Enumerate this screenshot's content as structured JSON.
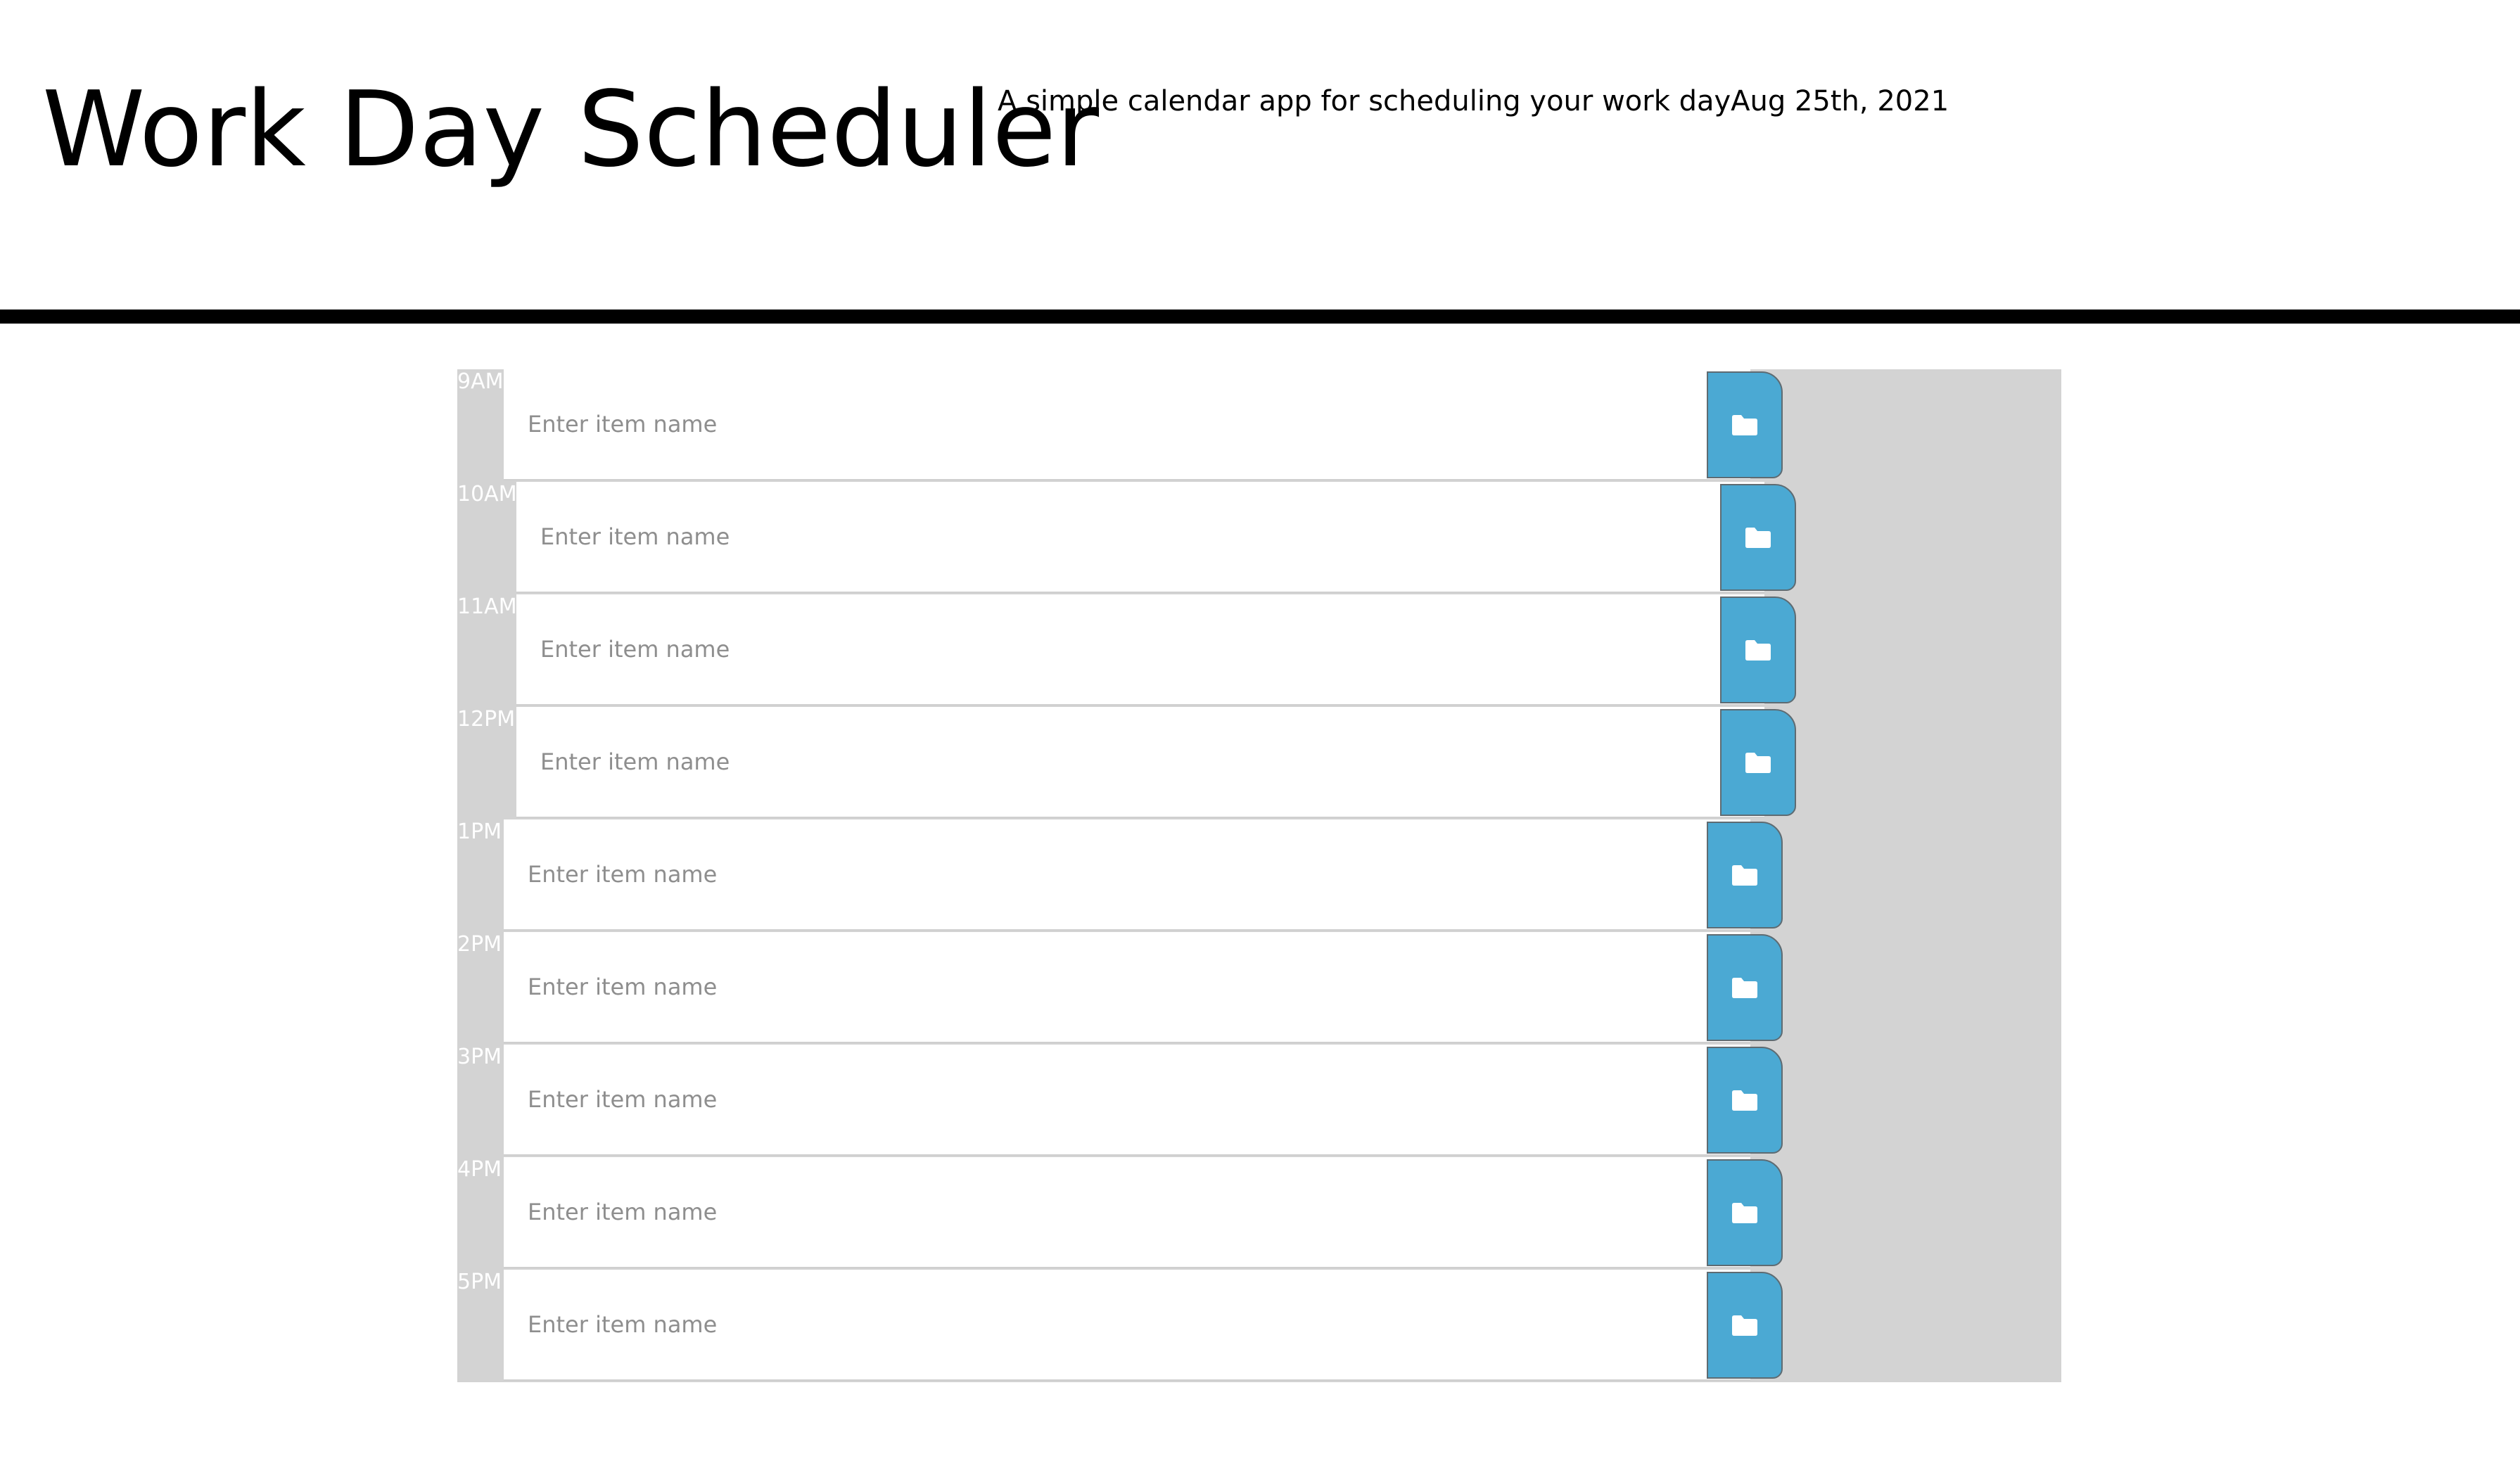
{
  "header": {
    "title": "Work Day Scheduler",
    "lead": "A simple calendar app for scheduling your work day",
    "current_day": "Aug 25th, 2021"
  },
  "planner": {
    "placeholder": "Enter item name",
    "rows": [
      {
        "hour": "9AM",
        "value": ""
      },
      {
        "hour": "10AM",
        "value": ""
      },
      {
        "hour": "11AM",
        "value": ""
      },
      {
        "hour": "12PM",
        "value": ""
      },
      {
        "hour": "1PM",
        "value": ""
      },
      {
        "hour": "2PM",
        "value": ""
      },
      {
        "hour": "3PM",
        "value": ""
      },
      {
        "hour": "4PM",
        "value": ""
      },
      {
        "hour": "5PM",
        "value": ""
      }
    ],
    "save_icon": "folder-icon"
  },
  "colors": {
    "save_button": "#4ba9d3",
    "time_block": "#d3d3d3",
    "divider": "#000000"
  }
}
